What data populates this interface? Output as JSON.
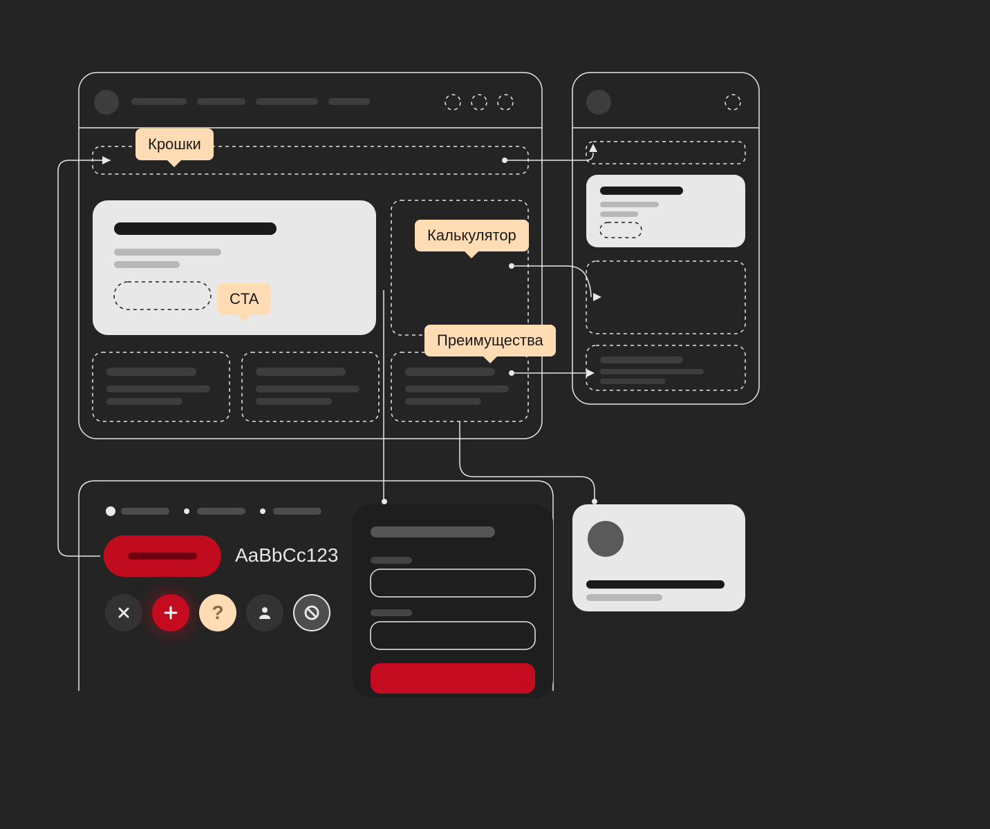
{
  "tooltips": {
    "breadcrumbs": "Крошки",
    "cta": "CTA",
    "calculator": "Калькулятор",
    "benefits": "Преимущества"
  },
  "typography_sample": "AaBbCc123",
  "icons": {
    "close": "close-icon",
    "add": "plus-icon",
    "help": "question-icon",
    "user": "user-icon",
    "ban": "ban-icon"
  },
  "colors": {
    "bg": "#242424",
    "tooltip_bg": "#ffdcb3",
    "accent_red": "#c40b1f",
    "stroke": "#e8e8e8"
  }
}
